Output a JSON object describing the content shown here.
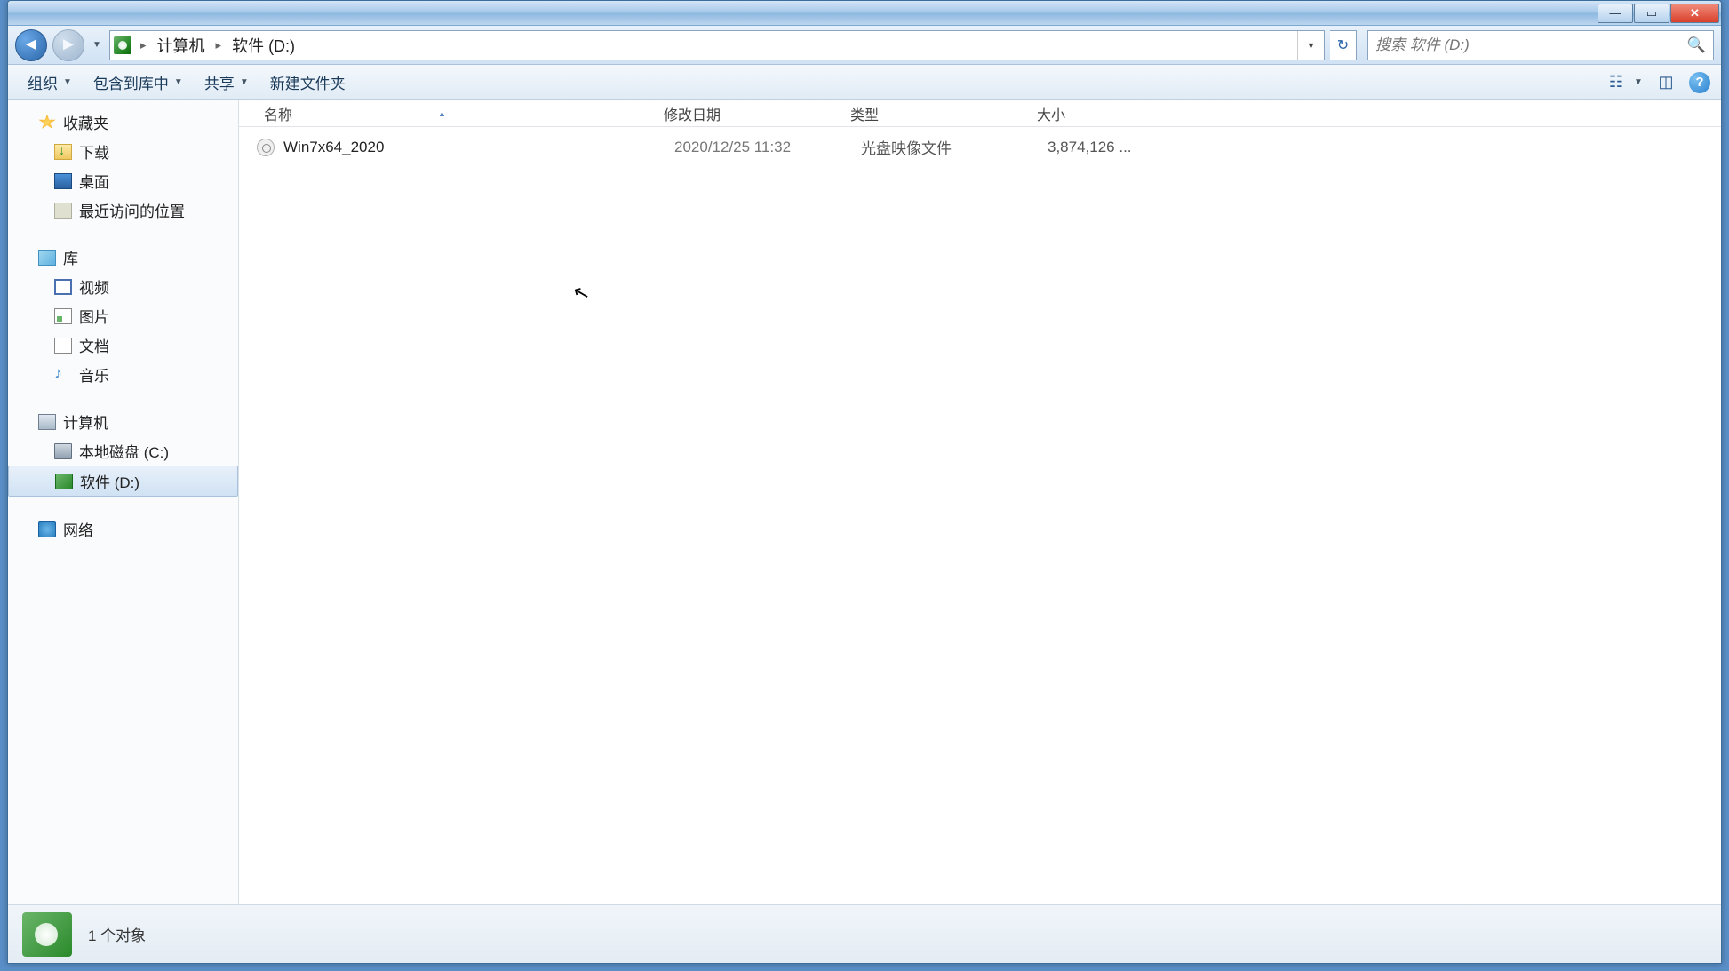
{
  "breadcrumb": {
    "computer": "计算机",
    "drive": "软件 (D:)"
  },
  "search": {
    "placeholder": "搜索 软件 (D:)"
  },
  "toolbar": {
    "organize": "组织",
    "include": "包含到库中",
    "share": "共享",
    "new_folder": "新建文件夹"
  },
  "columns": {
    "name": "名称",
    "date": "修改日期",
    "type": "类型",
    "size": "大小"
  },
  "sidebar": {
    "favorites": "收藏夹",
    "downloads": "下载",
    "desktop": "桌面",
    "recent": "最近访问的位置",
    "libraries": "库",
    "videos": "视频",
    "pictures": "图片",
    "documents": "文档",
    "music": "音乐",
    "computer": "计算机",
    "disk_c": "本地磁盘 (C:)",
    "disk_d": "软件 (D:)",
    "network": "网络"
  },
  "files": [
    {
      "name": "Win7x64_2020",
      "date": "2020/12/25 11:32",
      "type": "光盘映像文件",
      "size": "3,874,126 ..."
    }
  ],
  "status": {
    "text": "1 个对象"
  }
}
